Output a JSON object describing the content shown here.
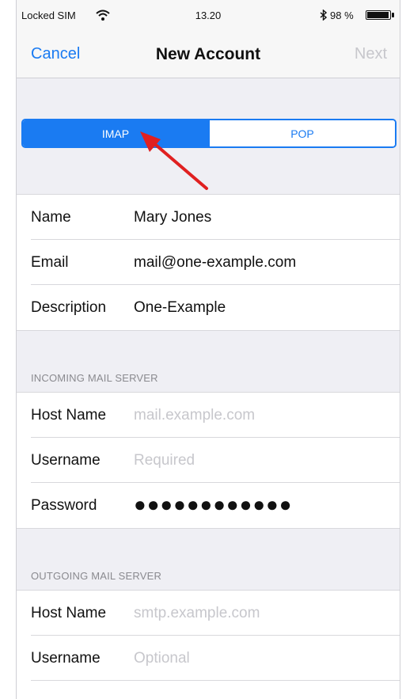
{
  "status_bar": {
    "carrier": "Locked SIM",
    "time": "13.20",
    "battery": "98 %"
  },
  "nav": {
    "cancel": "Cancel",
    "title": "New Account",
    "next": "Next"
  },
  "segmented": {
    "options": [
      "IMAP",
      "POP"
    ],
    "selected": "IMAP"
  },
  "account": {
    "rows": [
      {
        "label": "Name",
        "value": "Mary Jones"
      },
      {
        "label": "Email",
        "value": "mail@one-example.com"
      },
      {
        "label": "Description",
        "value": "One-Example"
      }
    ]
  },
  "incoming": {
    "header": "INCOMING MAIL SERVER",
    "rows": [
      {
        "label": "Host Name",
        "placeholder": "mail.example.com"
      },
      {
        "label": "Username",
        "placeholder": "Required"
      },
      {
        "label": "Password",
        "value": "●●●●●●●●●●●●"
      }
    ]
  },
  "outgoing": {
    "header": "OUTGOING MAIL SERVER",
    "rows": [
      {
        "label": "Host Name",
        "placeholder": "smtp.example.com"
      },
      {
        "label": "Username",
        "placeholder": "Optional"
      }
    ]
  },
  "colors": {
    "accent": "#1a7bf2",
    "annotation_arrow": "#e02020",
    "placeholder": "#c7c7cc"
  },
  "icons": [
    "wifi-icon",
    "bluetooth-icon",
    "battery-icon",
    "red-arrow-annotation"
  ]
}
